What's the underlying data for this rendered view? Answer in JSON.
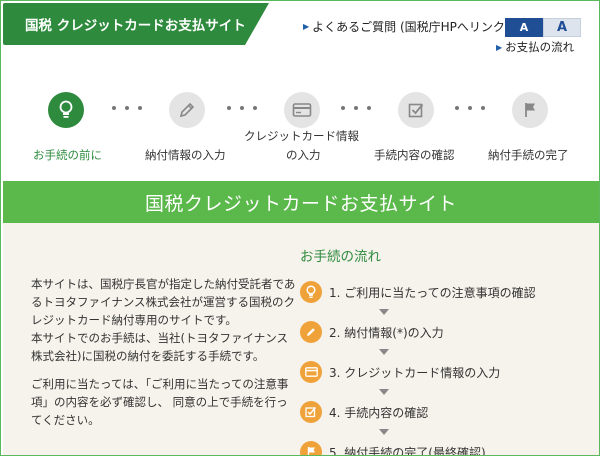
{
  "header": {
    "site_tab": "国税 クレジットカードお支払サイト",
    "faq_link": "よくあるご質問 (国税庁HPへリンク)",
    "flow_link": "お支払の流れ",
    "font_small": "A",
    "font_large": "A"
  },
  "stepper": {
    "steps": [
      {
        "label": "お手続の前に",
        "icon": "lightbulb-icon",
        "active": true
      },
      {
        "label": "納付情報の入力",
        "icon": "pencil-icon",
        "active": false
      },
      {
        "label_line1": "クレジットカード情報",
        "label_line2": "の入力",
        "icon": "credit-card-icon",
        "active": false
      },
      {
        "label": "手続内容の確認",
        "icon": "checkbox-icon",
        "active": false
      },
      {
        "label": "納付手続の完了",
        "icon": "flag-icon",
        "active": false
      }
    ]
  },
  "banner": {
    "title": "国税クレジットカードお支払サイト"
  },
  "intro": {
    "p1_line1": "本サイトは、国税庁長官が指定した納付受託者であ",
    "p1_line2": "るトヨタファイナンス株式会社が運営する国税のク",
    "p1_line3": "レジットカード納付専用のサイトです。",
    "p1_line4": "本サイトでのお手続は、当社(トヨタファイナンス",
    "p1_line5": "株式会社)に国税の納付を委託する手続です。",
    "p2_line1": "ご利用に当たっては、「ご利用に当たっての注意事",
    "p2_line2": "項」の内容を必ず確認し、 同意の上で手続を行っ",
    "p2_line3": "てください。"
  },
  "flow": {
    "title": "お手続の流れ",
    "steps": [
      {
        "label": "1. ご利用に当たっての注意事項の確認",
        "icon": "lightbulb-icon"
      },
      {
        "label": "2. 納付情報(*)の入力",
        "icon": "pencil-icon"
      },
      {
        "label": "3. クレジットカード情報の入力",
        "icon": "credit-card-icon"
      },
      {
        "label": "4. 手続内容の確認",
        "icon": "checkbox-icon"
      },
      {
        "label": "5. 納付手続の完了(最終確認)",
        "icon": "flag-icon"
      }
    ]
  },
  "colors": {
    "brand_green": "#2e8b3e",
    "banner_green": "#5bb84b",
    "accent_orange": "#f0a23a",
    "link_blue": "#1f4e94"
  }
}
